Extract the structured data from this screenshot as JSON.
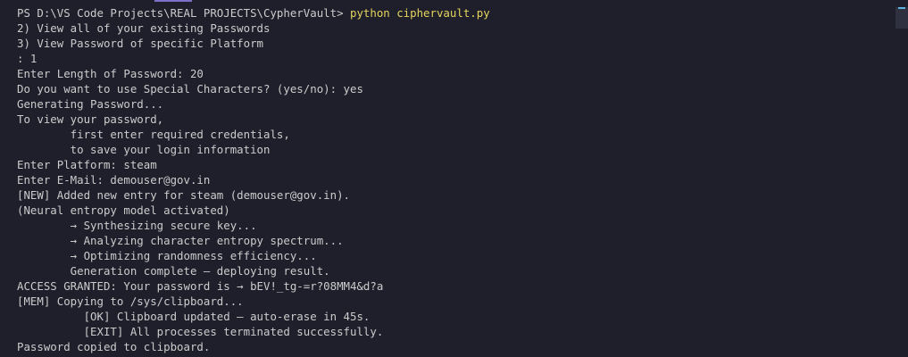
{
  "terminal": {
    "prompt": "PS D:\\VS Code Projects\\REAL PROJECTS\\CypherVault> ",
    "command": "python ciphervault.py",
    "lines": [
      "2) View all of your existing Passwords",
      "3) View Password of specific Platform",
      ": 1",
      "Enter Length of Password: 20",
      "Do you want to use Special Characters? (yes/no): yes",
      "Generating Password...",
      "To view your password,",
      "        first enter required credentials,",
      "        to save your login information",
      "Enter Platform: steam",
      "Enter E-Mail: demouser@gov.in",
      "[NEW] Added new entry for steam (demouser@gov.in).",
      "(Neural entropy model activated)",
      "        → Synthesizing secure key...",
      "        → Analyzing character entropy spectrum...",
      "        → Optimizing randomness efficiency...",
      "        Generation complete — deploying result.",
      "ACCESS GRANTED: Your password is → bEV!_tg-=r?08MM4&d?a",
      "[MEM] Copying to /sys/clipboard...",
      "          [OK] Clipboard updated — auto-erase in 45s.",
      "          [EXIT] All processes terminated successfully.",
      "Password copied to clipboard."
    ]
  }
}
